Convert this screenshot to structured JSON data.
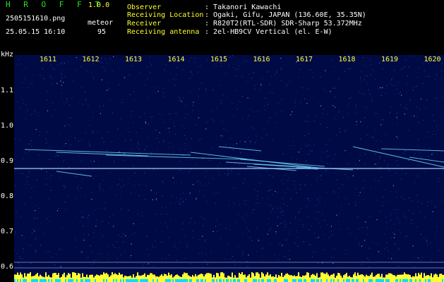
{
  "header": {
    "app_title": "H R O F F T",
    "app_version": "1.0.0",
    "file_name": "2505151610.png",
    "date_time": "25.05.15 16:10",
    "mode_label": "meteor",
    "mode_count": "95"
  },
  "info": [
    {
      "label": "Observer",
      "value": "Takanori Kawachi"
    },
    {
      "label": "Receiving Location",
      "value": "Ogaki, Gifu, JAPAN (136.60E, 35.35N)"
    },
    {
      "label": "Receiver",
      "value": "R820T2(RTL-SDR) SDR-Sharp 53.372MHz"
    },
    {
      "label": "Receiving antenna",
      "value": "2el-HB9CV Vertical (el. E-W)"
    }
  ],
  "axis": {
    "unit": "kHz",
    "x_ticks": [
      "1611",
      "1612",
      "1613",
      "1614",
      "1615",
      "1616",
      "1617",
      "1618",
      "1619",
      "1620"
    ],
    "y_ticks": [
      "1.1",
      "1.0",
      "0.9",
      "0.8",
      "0.7",
      "0.6"
    ]
  },
  "colors": {
    "background": "#000a44",
    "carrier": "#a0c8ff",
    "meteor_trace": "#6fd8ff",
    "bar": "#ffff30",
    "bar_base": "#00e0ff"
  }
}
